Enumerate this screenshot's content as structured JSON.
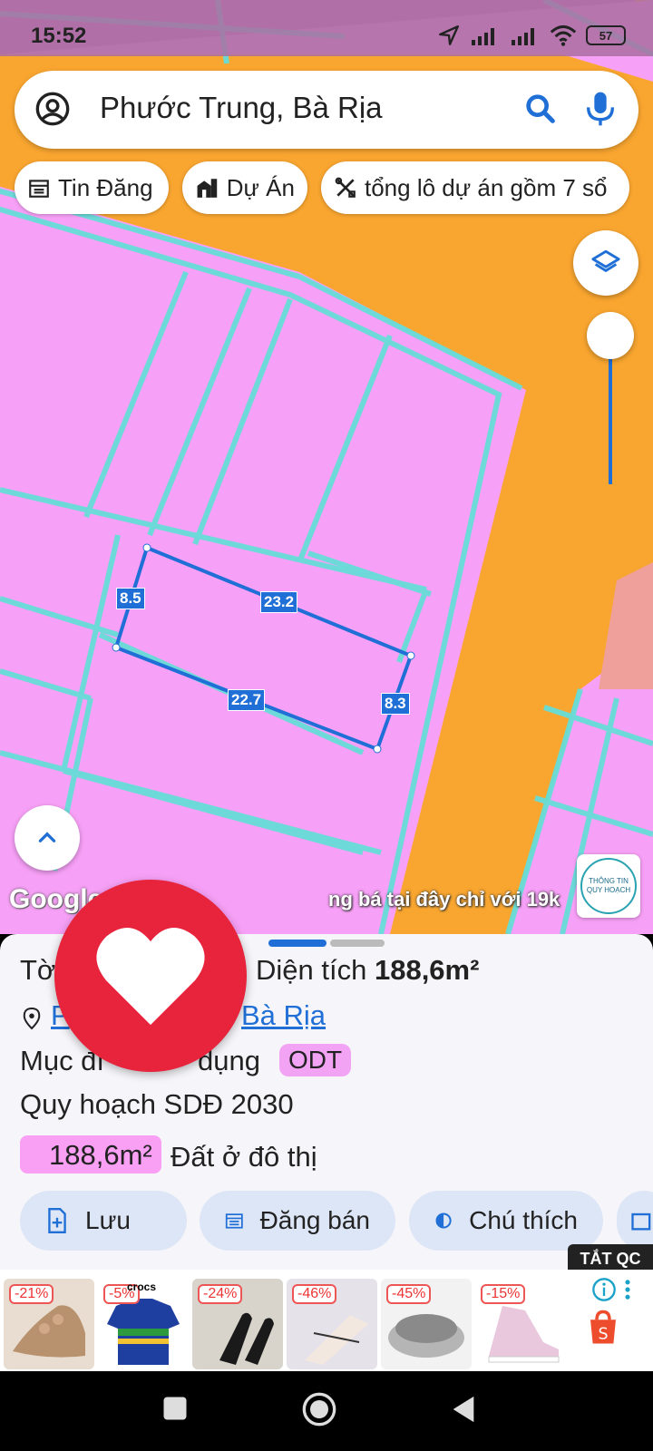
{
  "status_bar": {
    "time": "15:52",
    "battery": "57"
  },
  "search": {
    "query": "Phước Trung, Bà Rịa"
  },
  "chips": [
    {
      "label": "Tin Đăng",
      "icon": "calendar-icon"
    },
    {
      "label": "Dự Án",
      "icon": "building-icon"
    },
    {
      "label": "tổng lô dự án gồm 7 sổ",
      "icon": "tools-icon"
    }
  ],
  "map": {
    "segments": [
      "8.5",
      "23.2",
      "22.7",
      "8.3"
    ],
    "google_logo": "Google",
    "promo_text": "ng bá tại đây chỉ với 19k",
    "info_badge": [
      "THÔNG TIN",
      "QUY HOẠCH"
    ],
    "colors": {
      "residential": "#f7a0f7",
      "road": "#f9a630",
      "parcel_border": "#66ddd8",
      "selection": "#1f6fd6"
    }
  },
  "sheet": {
    "title_prefix": "Tờ",
    "area_label": "Diện tích",
    "area_value": "188,6m²",
    "address_start": "P",
    "address_end": "Bà Rịa",
    "purpose_prefix": "Mục đí",
    "purpose_suffix": "dụng",
    "purpose_tag": "ODT",
    "plan_label": "Quy hoạch SDĐ 2030",
    "plan_area": "188,6m²",
    "plan_type": "Đất ở đô thị"
  },
  "actions": [
    {
      "label": "Lưu",
      "icon": "save-icon"
    },
    {
      "label": "Đăng bán",
      "icon": "calendar-list-icon"
    },
    {
      "label": "Chú thích",
      "icon": "contrast-icon"
    }
  ],
  "ad": {
    "close_label": "TẮT QC",
    "discounts": [
      "-21%",
      "-5%",
      "-24%",
      "-46%",
      "-45%",
      "-15%"
    ],
    "brand": "crocs"
  }
}
